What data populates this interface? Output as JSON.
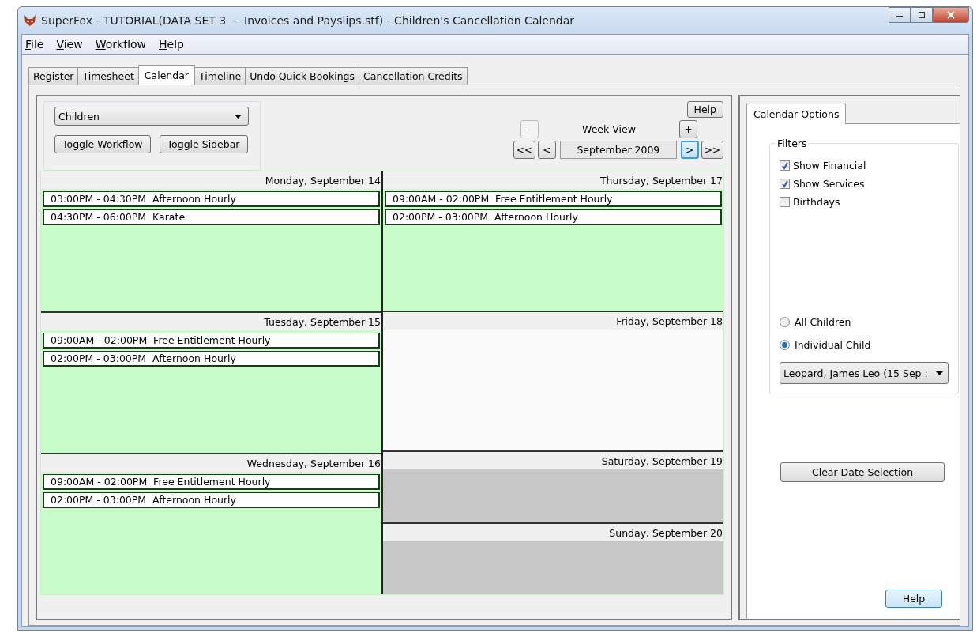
{
  "window": {
    "title": "SuperFox - TUTORIAL(DATA SET 3  -  Invoices and Payslips.stf) - Children's Cancellation Calendar"
  },
  "menu": [
    "File",
    "View",
    "Workflow",
    "Help"
  ],
  "tabs": [
    {
      "label": "Register",
      "selected": false
    },
    {
      "label": "Timesheet",
      "selected": false
    },
    {
      "label": "Calendar",
      "selected": true
    },
    {
      "label": "Timeline",
      "selected": false
    },
    {
      "label": "Undo Quick Bookings",
      "selected": false
    },
    {
      "label": "Cancellation Credits",
      "selected": false
    }
  ],
  "toolbar": {
    "mode_select": "Children",
    "buttons": [
      "Toggle Workflow",
      "Toggle Sidebar"
    ],
    "help": "Help"
  },
  "navigation": {
    "zoom_out": {
      "label": "-",
      "disabled": true
    },
    "view_label": "Week View",
    "zoom_in": {
      "label": "+",
      "disabled": false
    },
    "back_buttons": [
      {
        "label": "<<",
        "focused": false
      },
      {
        "label": "<",
        "focused": false
      }
    ],
    "period": "September 2009",
    "forward_buttons": [
      {
        "label": ">",
        "focused": true
      },
      {
        "label": ">>",
        "focused": false
      }
    ]
  },
  "calendar": [
    {
      "days": [
        {
          "date": "Monday, September 14",
          "kind": "booked",
          "events": [
            "03:00PM - 04:30PM  Afternoon Hourly",
            "04:30PM - 06:00PM  Karate"
          ]
        },
        {
          "date": "Tuesday, September 15",
          "kind": "booked",
          "events": [
            "09:00AM - 02:00PM  Free Entitlement Hourly",
            "02:00PM - 03:00PM  Afternoon Hourly"
          ]
        },
        {
          "date": "Wednesday, September 16",
          "kind": "booked",
          "events": [
            "09:00AM - 02:00PM  Free Entitlement Hourly",
            "02:00PM - 03:00PM  Afternoon Hourly"
          ]
        }
      ]
    },
    {
      "days": [
        {
          "date": "Thursday, September 17",
          "kind": "booked",
          "events": [
            "09:00AM - 02:00PM  Free Entitlement Hourly",
            "02:00PM - 03:00PM  Afternoon Hourly"
          ]
        },
        {
          "date": "Friday, September 18",
          "kind": "empty"
        },
        {
          "date": "Saturday, September 19",
          "kind": "weekend"
        },
        {
          "date": "Sunday, September 20",
          "kind": "weekend"
        }
      ]
    }
  ],
  "sidebar": {
    "tab": "Calendar Options",
    "filters_title": "Filters",
    "filters": [
      {
        "label": "Show Financial",
        "checked": true
      },
      {
        "label": "Show Services",
        "checked": true
      },
      {
        "label": "Birthdays",
        "checked": false
      }
    ],
    "scope": [
      {
        "label": "All Children",
        "selected": false
      },
      {
        "label": "Individual Child",
        "selected": true
      }
    ],
    "child_select": "Leopard, James Leo (15 Sep :",
    "clear_button": "Clear Date Selection",
    "help": "Help"
  }
}
